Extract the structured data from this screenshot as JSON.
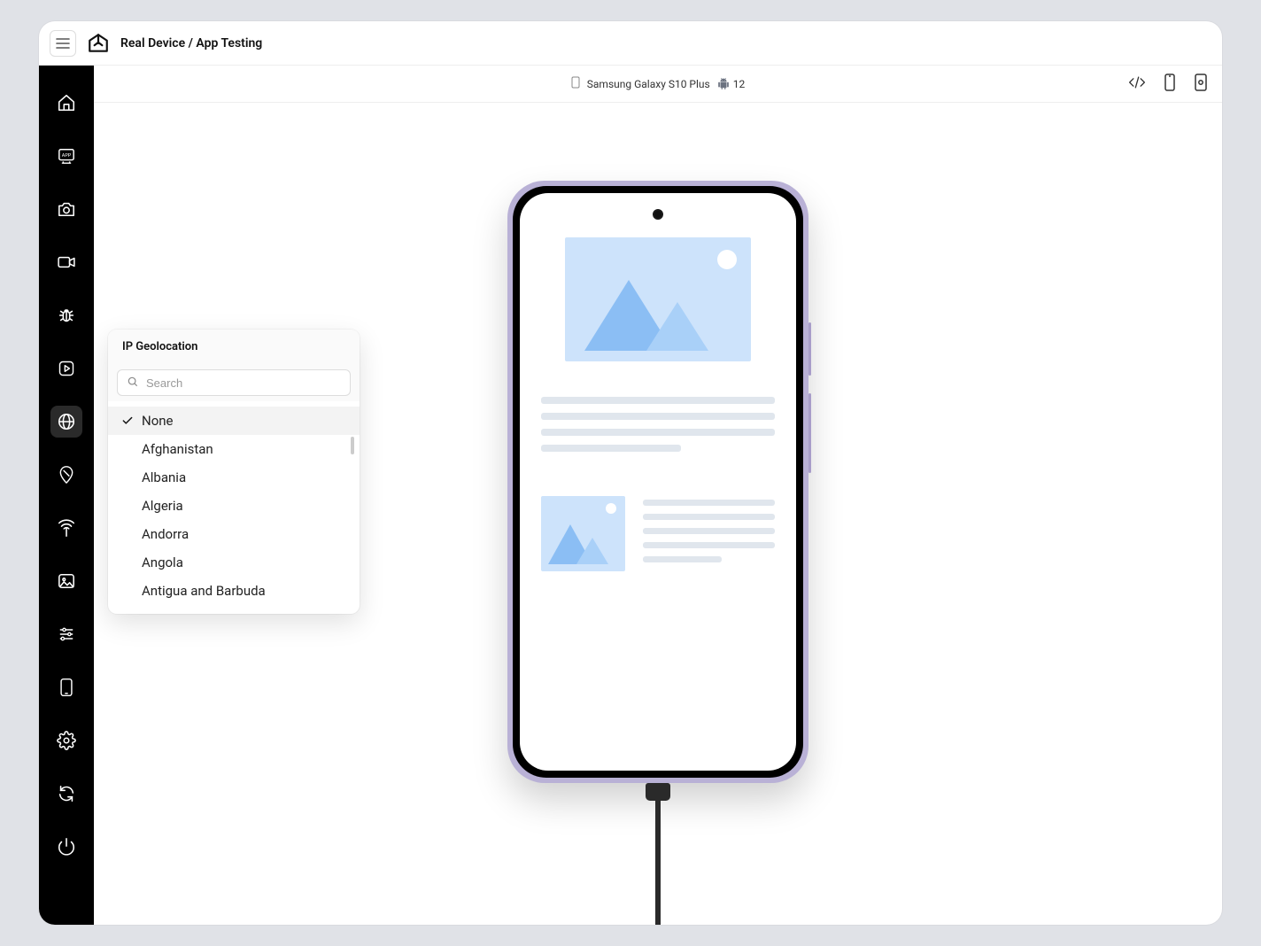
{
  "header": {
    "breadcrumb": "Real Device / App Testing"
  },
  "device": {
    "name": "Samsung Galaxy S10 Plus",
    "os_version": "12"
  },
  "popover": {
    "title": "IP Geolocation",
    "search_placeholder": "Search",
    "selected": "None",
    "options": [
      "None",
      "Afghanistan",
      "Albania",
      "Algeria",
      "Andorra",
      "Angola",
      "Antigua and Barbuda"
    ]
  },
  "sidebar": {
    "items": [
      {
        "name": "home-icon"
      },
      {
        "name": "app-icon"
      },
      {
        "name": "camera-icon"
      },
      {
        "name": "video-icon"
      },
      {
        "name": "bug-icon"
      },
      {
        "name": "play-icon"
      },
      {
        "name": "globe-icon",
        "active": true
      },
      {
        "name": "location-icon"
      },
      {
        "name": "network-icon"
      },
      {
        "name": "image-icon"
      },
      {
        "name": "sliders-icon"
      },
      {
        "name": "device-icon"
      },
      {
        "name": "settings-icon"
      },
      {
        "name": "refresh-icon"
      },
      {
        "name": "power-icon"
      }
    ]
  }
}
